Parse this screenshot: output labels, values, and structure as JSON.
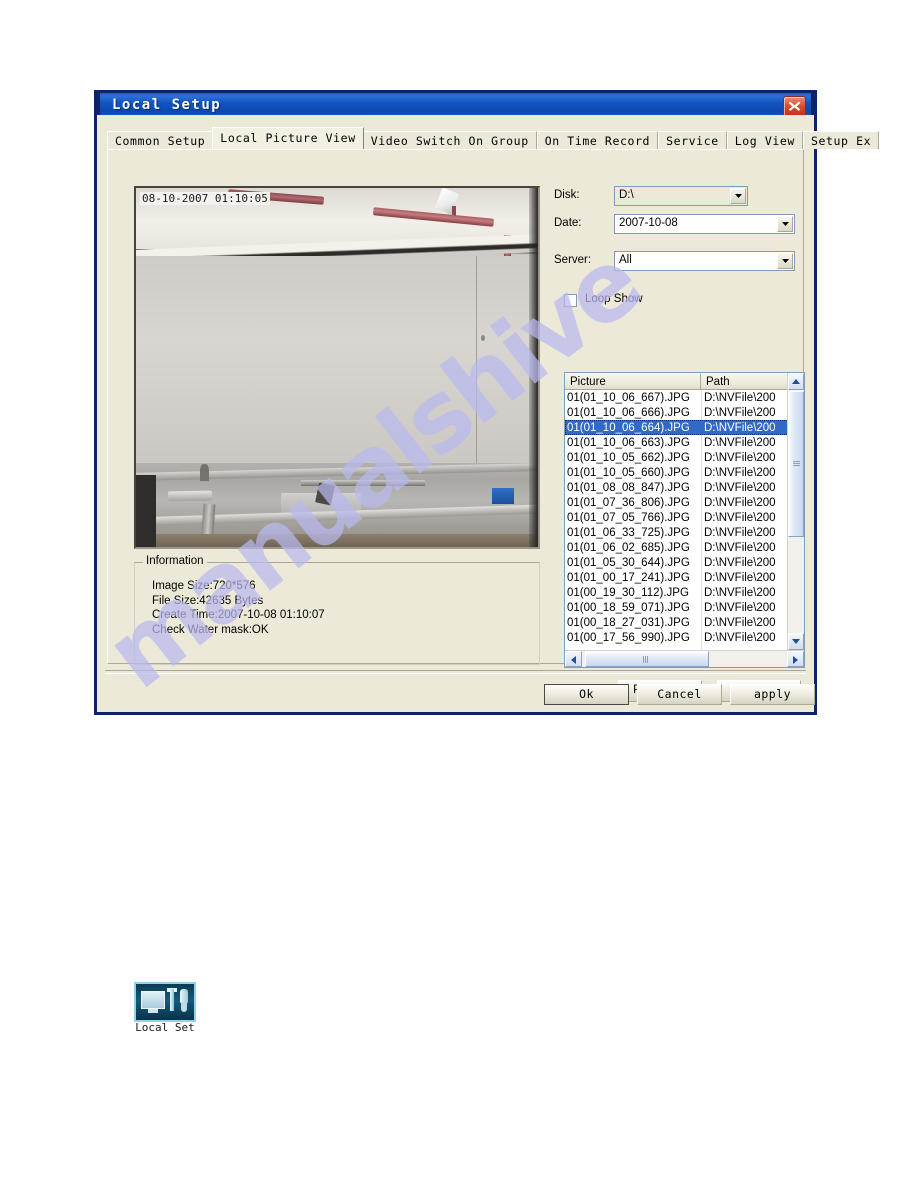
{
  "window": {
    "title": "Local Setup",
    "close_icon": "close-icon"
  },
  "tabs": [
    {
      "label": "Common Setup",
      "active": false
    },
    {
      "label": "Local Picture View",
      "active": true
    },
    {
      "label": "Video Switch On Group",
      "active": false
    },
    {
      "label": "On Time Record",
      "active": false
    },
    {
      "label": "Service",
      "active": false
    },
    {
      "label": "Log View",
      "active": false
    },
    {
      "label": "Setup Ex",
      "active": false
    }
  ],
  "preview": {
    "timestamp_overlay": "08-10-2007 01:10:05"
  },
  "information": {
    "legend": "Information",
    "lines": [
      "Image Size:720*576",
      "File Size:42635 Bytes",
      "Create Time:2007-10-08 01:10:07",
      "Check Water mask:OK"
    ]
  },
  "form": {
    "disk": {
      "label": "Disk:",
      "value": "D:\\"
    },
    "date": {
      "label": "Date:",
      "value": "2007-10-08"
    },
    "server": {
      "label": "Server:",
      "value": "All"
    },
    "loop_show": {
      "label": "Loop Show",
      "checked": false
    }
  },
  "list": {
    "columns": [
      "Picture",
      "Path"
    ],
    "selected_index": 2,
    "rows": [
      {
        "picture": "01(01_10_06_667).JPG",
        "path": "D:\\NVFile\\200"
      },
      {
        "picture": "01(01_10_06_666).JPG",
        "path": "D:\\NVFile\\200"
      },
      {
        "picture": "01(01_10_06_664).JPG",
        "path": "D:\\NVFile\\200"
      },
      {
        "picture": "01(01_10_06_663).JPG",
        "path": "D:\\NVFile\\200"
      },
      {
        "picture": "01(01_10_05_662).JPG",
        "path": "D:\\NVFile\\200"
      },
      {
        "picture": "01(01_10_05_660).JPG",
        "path": "D:\\NVFile\\200"
      },
      {
        "picture": "01(01_08_08_847).JPG",
        "path": "D:\\NVFile\\200"
      },
      {
        "picture": "01(01_07_36_806).JPG",
        "path": "D:\\NVFile\\200"
      },
      {
        "picture": "01(01_07_05_766).JPG",
        "path": "D:\\NVFile\\200"
      },
      {
        "picture": "01(01_06_33_725).JPG",
        "path": "D:\\NVFile\\200"
      },
      {
        "picture": "01(01_06_02_685).JPG",
        "path": "D:\\NVFile\\200"
      },
      {
        "picture": "01(01_05_30_644).JPG",
        "path": "D:\\NVFile\\200"
      },
      {
        "picture": "01(01_00_17_241).JPG",
        "path": "D:\\NVFile\\200"
      },
      {
        "picture": "01(00_19_30_112).JPG",
        "path": "D:\\NVFile\\200"
      },
      {
        "picture": "01(00_18_59_071).JPG",
        "path": "D:\\NVFile\\200"
      },
      {
        "picture": "01(00_18_27_031).JPG",
        "path": "D:\\NVFile\\200"
      },
      {
        "picture": "01(00_17_56_990).JPG",
        "path": "D:\\NVFile\\200"
      }
    ]
  },
  "buttons": {
    "printet_set": "Printet Set",
    "print": "Print",
    "ok": "Ok",
    "cancel": "Cancel",
    "apply": "apply"
  },
  "desktop_icon": {
    "label": "Local Set",
    "icon": "local-setup-icon"
  },
  "watermark": {
    "text": "manualshive"
  },
  "colors": {
    "titlebar": "#0b49b0",
    "dialog_face": "#ece9d8",
    "selection": "#316ac5",
    "close_button": "#e04a2c",
    "watermark": "#b9b9ef"
  }
}
